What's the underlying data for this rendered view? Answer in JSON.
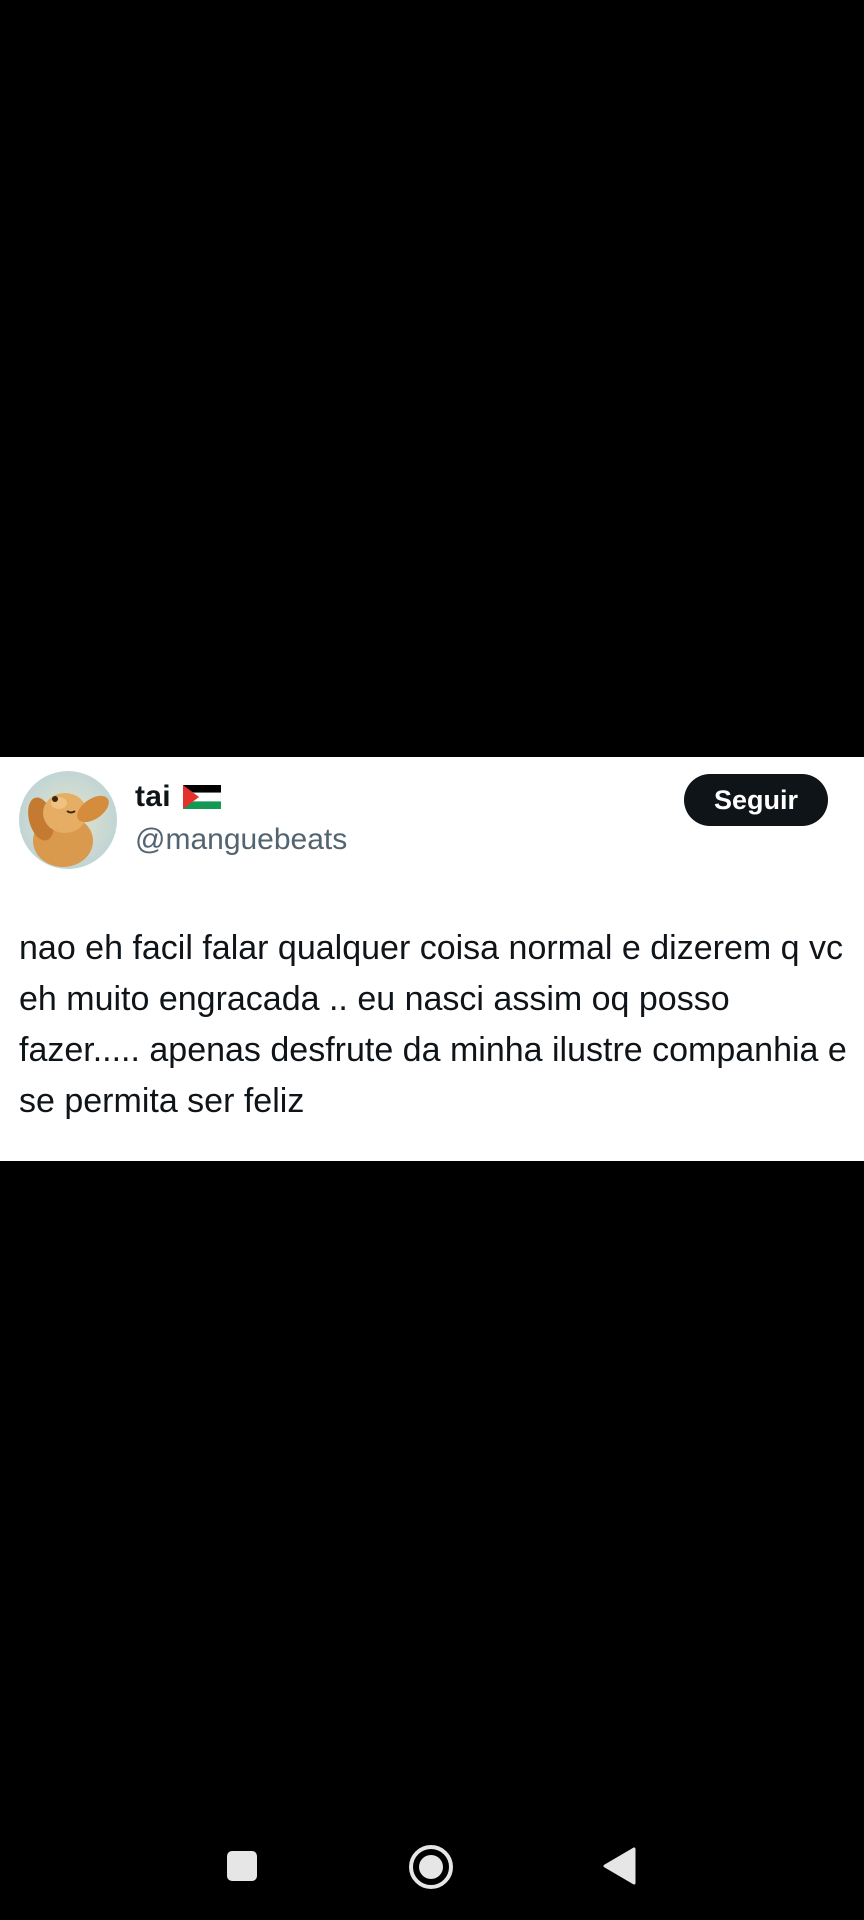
{
  "tweet": {
    "display_name": "tai",
    "handle": "@manguebeats",
    "follow_label": "Seguir",
    "text": "nao eh facil falar qualquer coisa normal e dizerem q vc eh muito engracada .. eu nasci assim oq posso fazer..... apenas desfrute da minha ilustre companhia e se permita ser feliz",
    "avatar_icon": "dog-avatar",
    "flag_icon": "palestine-flag-icon"
  },
  "navigation": {
    "recent_icon": "square-recents-icon",
    "home_icon": "circle-home-icon",
    "back_icon": "triangle-back-icon"
  },
  "colors": {
    "background": "#000000",
    "card": "#ffffff",
    "text": "#0f1419",
    "secondary_text": "#536471",
    "button": "#0f1419"
  }
}
